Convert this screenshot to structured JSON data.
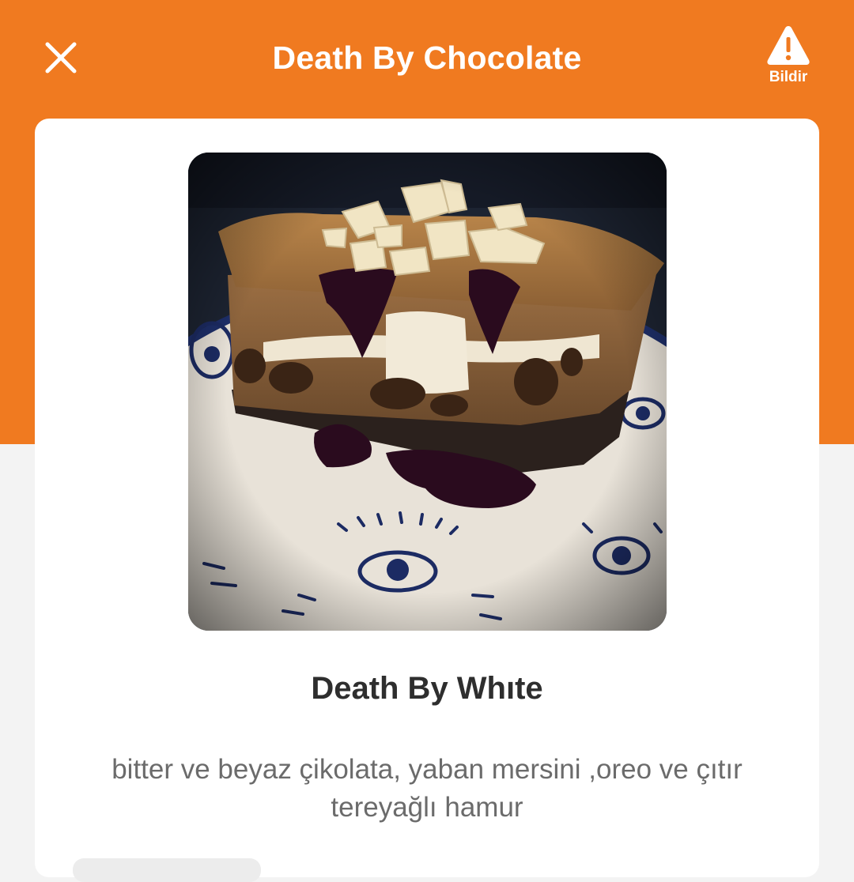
{
  "header": {
    "title": "Death By Chocolate",
    "close_icon": "close-icon",
    "report_icon": "warning-triangle-icon",
    "report_label": "Bildir"
  },
  "product": {
    "image_alt": "Death By Whıte",
    "name": "Death By Whıte",
    "description": "bitter ve beyaz çikolata, yaban mersini ,oreo ve çıtır tereyağlı hamur"
  },
  "colors": {
    "header_bg": "#f07a20",
    "page_bg": "#f3f3f3",
    "card_bg": "#ffffff",
    "title_text": "#ffffff",
    "name_text": "#2e2e2e",
    "desc_text": "#6b6b6b"
  }
}
